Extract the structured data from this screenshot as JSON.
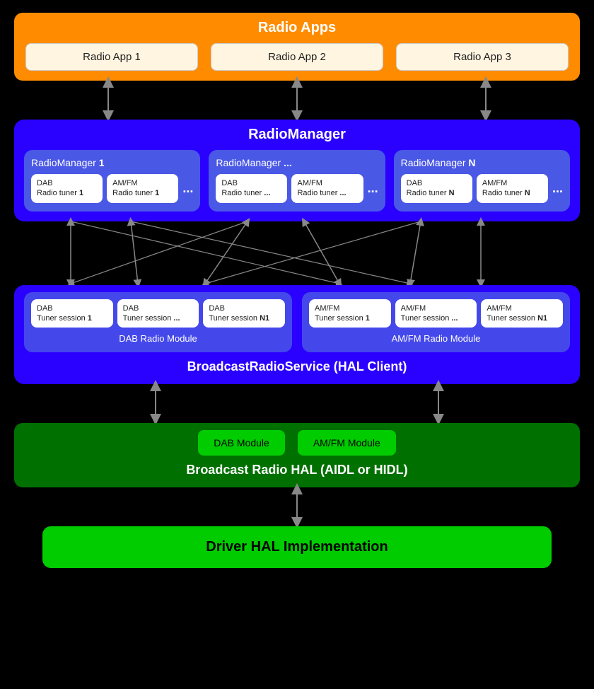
{
  "radioApps": {
    "sectionTitle": "Radio Apps",
    "apps": [
      "Radio App 1",
      "Radio App 2",
      "Radio App 3"
    ]
  },
  "radioManager": {
    "sectionTitle": "RadioManager",
    "managers": [
      {
        "title": "RadioManager ",
        "titleBold": "1",
        "tuners": [
          {
            "line1": "DAB",
            "line2": "Radio tuner ",
            "bold": "1"
          },
          {
            "line1": "AM/FM",
            "line2": "Radio tuner ",
            "bold": "1"
          }
        ]
      },
      {
        "title": "RadioManager ",
        "titleBold": "...",
        "tuners": [
          {
            "line1": "DAB",
            "line2": "Radio tuner ",
            "bold": "..."
          },
          {
            "line1": "AM/FM",
            "line2": "Radio tuner ",
            "bold": "..."
          }
        ]
      },
      {
        "title": "RadioManager ",
        "titleBold": "N",
        "tuners": [
          {
            "line1": "DAB",
            "line2": "Radio tuner ",
            "bold": "N"
          },
          {
            "line1": "AM/FM",
            "line2": "Radio tuner ",
            "bold": "N"
          }
        ]
      }
    ]
  },
  "broadcastRadioService": {
    "title": "BroadcastRadioService (HAL Client)",
    "dabModule": {
      "label": "DAB Radio Module",
      "sessions": [
        {
          "line1": "DAB",
          "line2": "Tuner session ",
          "bold": "1"
        },
        {
          "line1": "DAB",
          "line2": "Tuner session ",
          "bold": "..."
        },
        {
          "line1": "DAB",
          "line2": "Tuner session ",
          "bold": "N1"
        }
      ]
    },
    "amfmModule": {
      "label": "AM/FM Radio Module",
      "sessions": [
        {
          "line1": "AM/FM",
          "line2": "Tuner session ",
          "bold": "1"
        },
        {
          "line1": "AM/FM",
          "line2": "Tuner session ",
          "bold": "..."
        },
        {
          "line1": "AM/FM",
          "line2": "Tuner session ",
          "bold": "N1"
        }
      ]
    }
  },
  "broadcastRadioHAL": {
    "title": "Broadcast Radio HAL (AIDL or HIDL)",
    "modules": [
      "DAB Module",
      "AM/FM Module"
    ]
  },
  "driverHAL": {
    "title": "Driver HAL Implementation"
  }
}
